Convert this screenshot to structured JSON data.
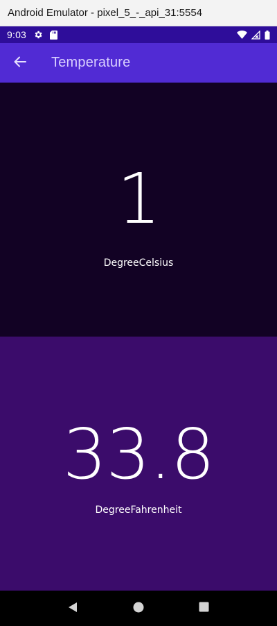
{
  "window": {
    "title": "Android Emulator - pixel_5_-_api_31:5554"
  },
  "status_bar": {
    "time": "9:03",
    "icons_left": [
      "gear-icon",
      "sd-card-icon"
    ],
    "icons_right": [
      "wifi-icon",
      "cellular-signal-icon",
      "battery-icon"
    ]
  },
  "app_bar": {
    "title": "Temperature",
    "back_icon": "arrow-left-icon"
  },
  "celsius": {
    "value": "1",
    "unit": "DegreeCelsius"
  },
  "fahrenheit": {
    "value": "33.8",
    "unit": "DegreeFahrenheit"
  },
  "nav_bar": {
    "icons": [
      "back-triangle-icon",
      "home-circle-icon",
      "recents-square-icon"
    ]
  },
  "colors": {
    "status_bar": "#2e0d9a",
    "app_bar": "#512bd4",
    "app_title": "#d9d0ff",
    "celsius_bg": "#120224",
    "fahrenheit_bg": "#3b0c6b",
    "nav_bar": "#000000"
  }
}
